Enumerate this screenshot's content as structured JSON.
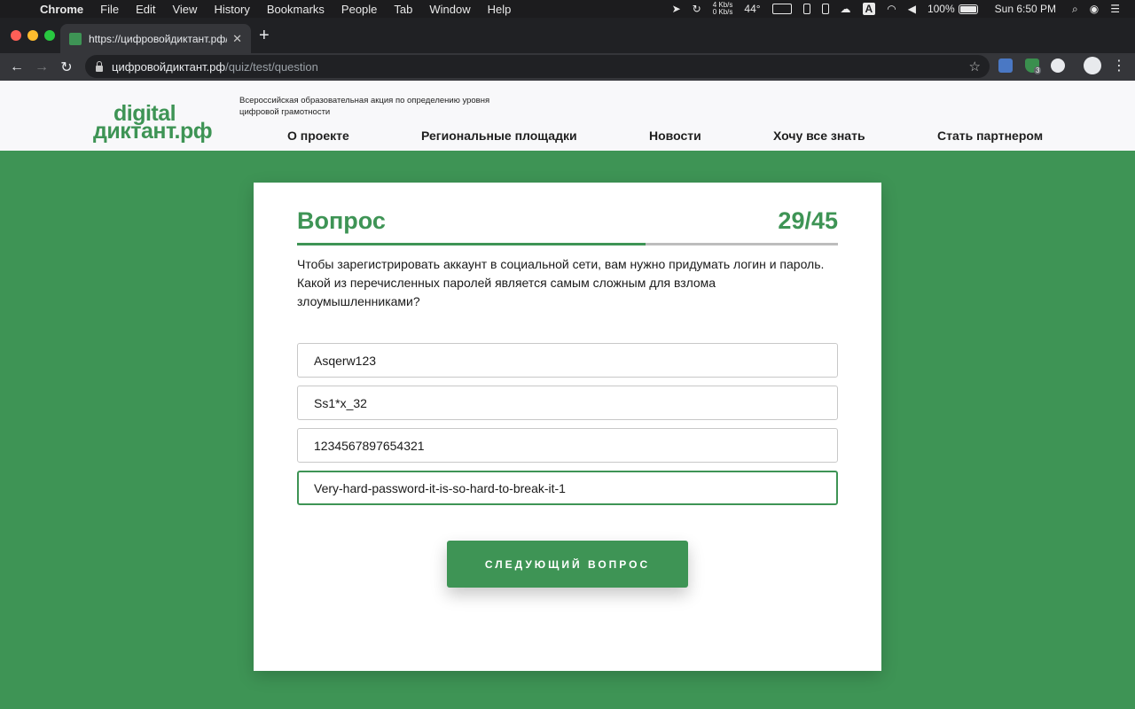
{
  "menubar": {
    "apple": "",
    "items": [
      "Chrome",
      "File",
      "Edit",
      "View",
      "History",
      "Bookmarks",
      "People",
      "Tab",
      "Window",
      "Help"
    ],
    "net_up": "4 Kb/s",
    "net_down": "0 Kb/s",
    "temperature": "44°",
    "input_source": "A",
    "battery": "100%",
    "clock": "Sun 6:50 PM"
  },
  "browser": {
    "tab_title": "https://цифровойдиктант.рф/qu",
    "close_glyph": "✕",
    "new_tab": "+",
    "back": "←",
    "forward": "→",
    "reload": "↻",
    "url_host": "цифровойдиктант.рф",
    "url_path": "/quiz/test/question",
    "star": "☆",
    "kebab": "⋮",
    "extension_badge": "3"
  },
  "site": {
    "logo_line1": "digital",
    "logo_line2": "диктант.рф",
    "tagline": "Всероссийская образовательная акция по определению уровня цифровой грамотности",
    "nav": [
      "О проекте",
      "Региональные площадки",
      "Новости",
      "Хочу все знать",
      "Стать партнером"
    ]
  },
  "quiz": {
    "title": "Вопрос",
    "counter": "29/45",
    "progress_fraction": 0.644,
    "question": "Чтобы зарегистрировать аккаунт в социальной сети, вам нужно придумать логин и пароль. Какой из перечисленных паролей является самым сложным для взлома злоумышленниками?",
    "answers": [
      "Asqerw123",
      "Ss1*x_32",
      "1234567897654321",
      "Very-hard-password-it-is-so-hard-to-break-it-1"
    ],
    "selected_index": 3,
    "next_button": "СЛЕДУЮЩИЙ ВОПРОС"
  },
  "colors": {
    "brand_green": "#3e9455",
    "page_background": "#3e9455",
    "card_background": "#ffffff"
  }
}
